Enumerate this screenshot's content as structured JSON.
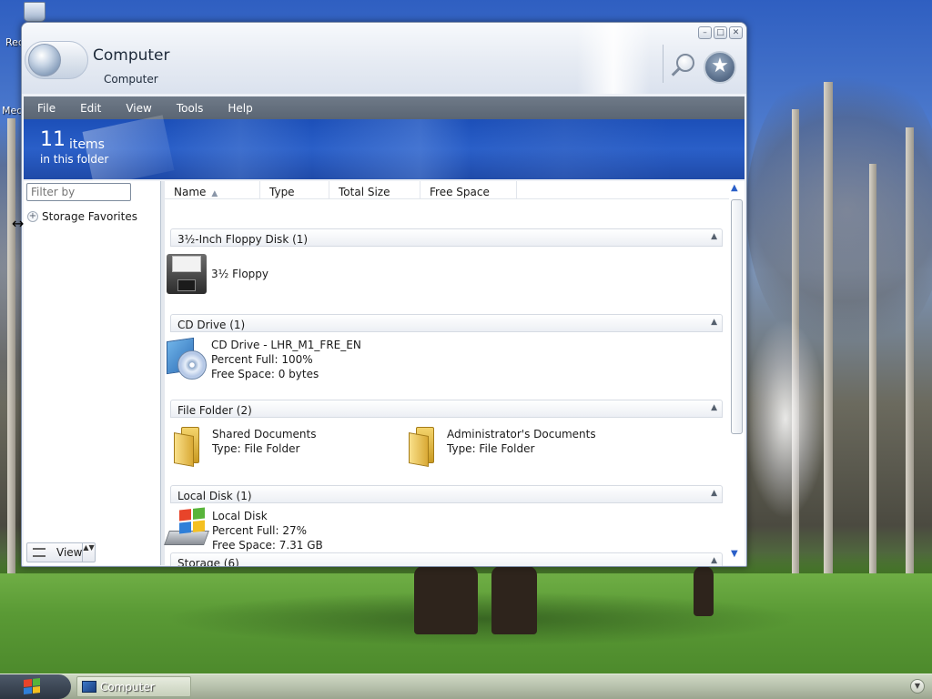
{
  "desktop": {
    "icons": [
      {
        "label": "Rec",
        "icon": "recycle-bin-icon"
      },
      {
        "label": "Med",
        "icon": "media-icon"
      }
    ]
  },
  "window": {
    "title": "Computer",
    "subtitle": "Computer",
    "controls": {
      "minimize": "–",
      "restore": "□",
      "close": "✕"
    },
    "search_icon": "magnifier-icon",
    "favorites_icon": "star-icon",
    "favorites_glyph": "★"
  },
  "menu": [
    "File",
    "Edit",
    "View",
    "Tools",
    "Help"
  ],
  "banner": {
    "count": "11",
    "items_label": "items",
    "subtitle": "in this folder"
  },
  "left_pane": {
    "filter_placeholder": "Filter by",
    "favorites_expander": "+",
    "favorites_label": "Storage Favorites",
    "view_label": "View",
    "view_spin": "▲▼"
  },
  "columns": [
    {
      "label": "Name",
      "sorted": "ascending"
    },
    {
      "label": "Type"
    },
    {
      "label": "Total Size"
    },
    {
      "label": "Free Space"
    }
  ],
  "sort_glyph": "▲",
  "collapse_glyph": "▲",
  "groups": [
    {
      "header": "3½-Inch Floppy Disk (1)",
      "items": [
        {
          "icon": "floppy-icon",
          "lines": [
            "3½ Floppy"
          ]
        }
      ]
    },
    {
      "header": "CD Drive (1)",
      "items": [
        {
          "icon": "cd-drive-icon",
          "lines": [
            "CD Drive - LHR_M1_FRE_EN",
            "Percent Full: 100%",
            "Free Space: 0 bytes"
          ]
        }
      ]
    },
    {
      "header": "File Folder (2)",
      "items": [
        {
          "icon": "folder-icon",
          "lines": [
            "Shared Documents",
            "Type: File Folder"
          ]
        },
        {
          "icon": "folder-icon",
          "lines": [
            "Administrator's Documents",
            "Type: File Folder"
          ]
        }
      ]
    },
    {
      "header": "Local Disk (1)",
      "items": [
        {
          "icon": "local-disk-icon",
          "lines": [
            "Local Disk",
            "Percent Full: 27%",
            "Free Space: 7.31 GB"
          ]
        }
      ]
    },
    {
      "header": "Storage (6)",
      "items": []
    }
  ],
  "scrollbar": {
    "up": "▲",
    "down": "▼"
  },
  "taskbar": {
    "start_icon": "windows-flag-icon",
    "task_label": "Computer",
    "tray_glyph": "▼"
  },
  "colors": {
    "accent_blue": "#2a5fc8",
    "menubar": "#5a6573",
    "flag_red": "#e8442a",
    "flag_green": "#58b43a",
    "flag_blue": "#2f7fd8",
    "flag_yellow": "#f5c020"
  }
}
